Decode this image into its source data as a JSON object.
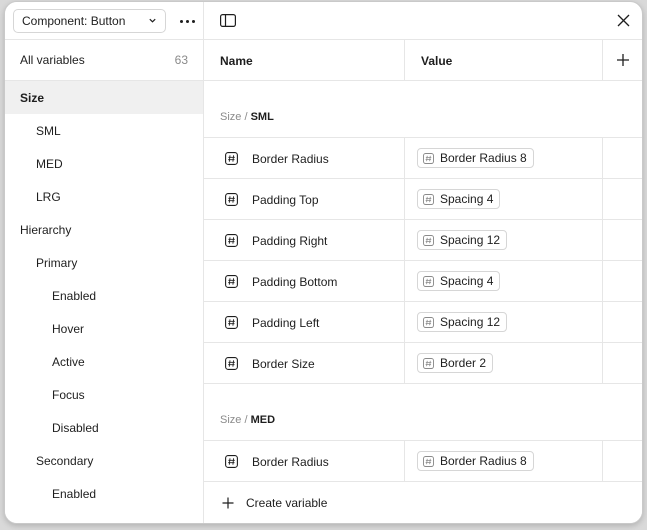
{
  "sidebar": {
    "collection_label": "Component: Button",
    "all_variables_label": "All variables",
    "all_variables_count": "63",
    "groups": [
      {
        "label": "Size",
        "level": 0,
        "selected": true
      },
      {
        "label": "SML",
        "level": 1
      },
      {
        "label": "MED",
        "level": 1
      },
      {
        "label": "LRG",
        "level": 1
      },
      {
        "label": "Hierarchy",
        "level": 0
      },
      {
        "label": "Primary",
        "level": 1
      },
      {
        "label": "Enabled",
        "level": 2
      },
      {
        "label": "Hover",
        "level": 2
      },
      {
        "label": "Active",
        "level": 2
      },
      {
        "label": "Focus",
        "level": 2
      },
      {
        "label": "Disabled",
        "level": 2
      },
      {
        "label": "Secondary",
        "level": 1
      },
      {
        "label": "Enabled",
        "level": 2
      }
    ]
  },
  "table": {
    "col_name": "Name",
    "col_value": "Value",
    "sections": [
      {
        "prefix": "Size /",
        "group": "SML",
        "rows": [
          {
            "name": "Border Radius",
            "value": "Border Radius 8"
          },
          {
            "name": "Padding Top",
            "value": "Spacing 4"
          },
          {
            "name": "Padding Right",
            "value": "Spacing 12"
          },
          {
            "name": "Padding Bottom",
            "value": "Spacing 4"
          },
          {
            "name": "Padding Left",
            "value": "Spacing 12"
          },
          {
            "name": "Border Size",
            "value": "Border 2"
          }
        ]
      },
      {
        "prefix": "Size /",
        "group": "MED",
        "rows": [
          {
            "name": "Border Radius",
            "value": "Border Radius 8"
          }
        ]
      }
    ]
  },
  "footer": {
    "create_label": "Create variable"
  },
  "icons": {
    "variable": "number-variable-icon",
    "panel": "sidebar-toggle-icon",
    "close": "close-icon",
    "add": "plus-icon"
  }
}
